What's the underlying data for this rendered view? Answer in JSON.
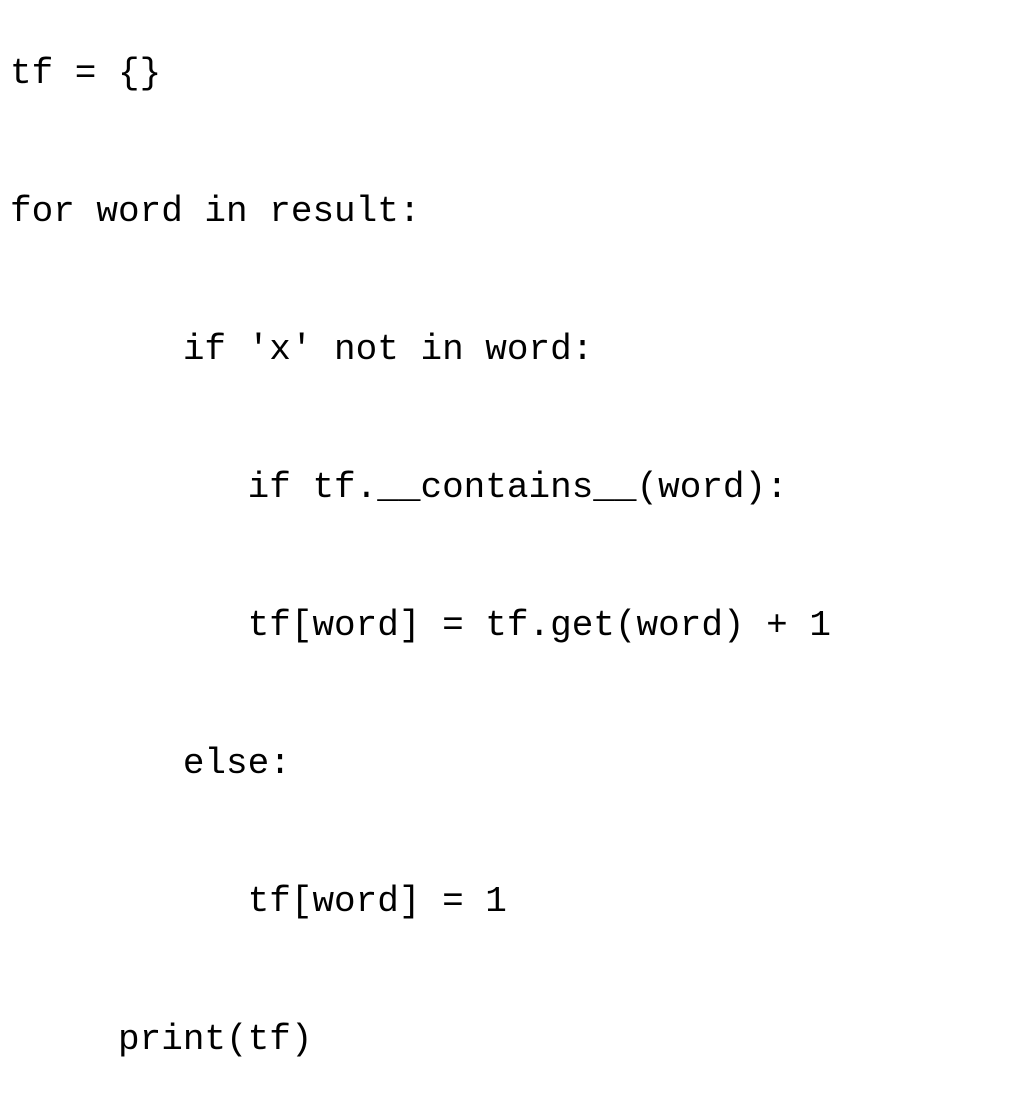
{
  "code": {
    "lines": [
      "tf = {}",
      "for word in result:",
      "        if 'x' not in word:",
      "           if tf.__contains__(word):",
      "           tf[word] = tf.get(word) + 1",
      "        else:",
      "           tf[word] = 1",
      "     print(tf)"
    ]
  }
}
